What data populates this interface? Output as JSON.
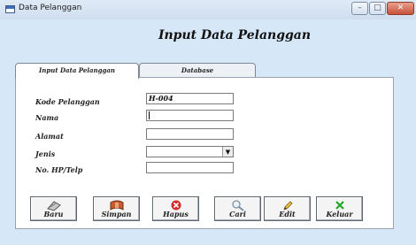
{
  "window": {
    "title": "Data Pelanggan",
    "controls": {
      "minimize": "–",
      "maximize": "□",
      "close": "✕"
    }
  },
  "form": {
    "heading": "Input Data Pelanggan",
    "tabs": [
      {
        "label": "Input Data Pelanggan",
        "active": true
      },
      {
        "label": "Database",
        "active": false
      }
    ],
    "fields": {
      "kode": {
        "label": "Kode Pelanggan",
        "value": "H-004"
      },
      "nama": {
        "label": "Nama",
        "value": ""
      },
      "alamat": {
        "label": "Alamat",
        "value": ""
      },
      "jenis": {
        "label": "Jenis",
        "value": ""
      },
      "telp": {
        "label": "No. HP/Telp",
        "value": ""
      }
    }
  },
  "buttons": [
    {
      "label": "Baru",
      "icon": "new-icon"
    },
    {
      "label": "Simpan",
      "icon": "save-icon"
    },
    {
      "label": "Hapus",
      "icon": "delete-icon"
    },
    {
      "label": "Cari",
      "icon": "search-icon"
    },
    {
      "label": "Edit",
      "icon": "pencil-icon"
    },
    {
      "label": "Keluar",
      "icon": "exit-icon"
    }
  ],
  "colors": {
    "window_bg": "#d6e7f8",
    "panel_bg": "#ffffff",
    "delete_red": "#d42a2a",
    "exit_green": "#26a626"
  }
}
